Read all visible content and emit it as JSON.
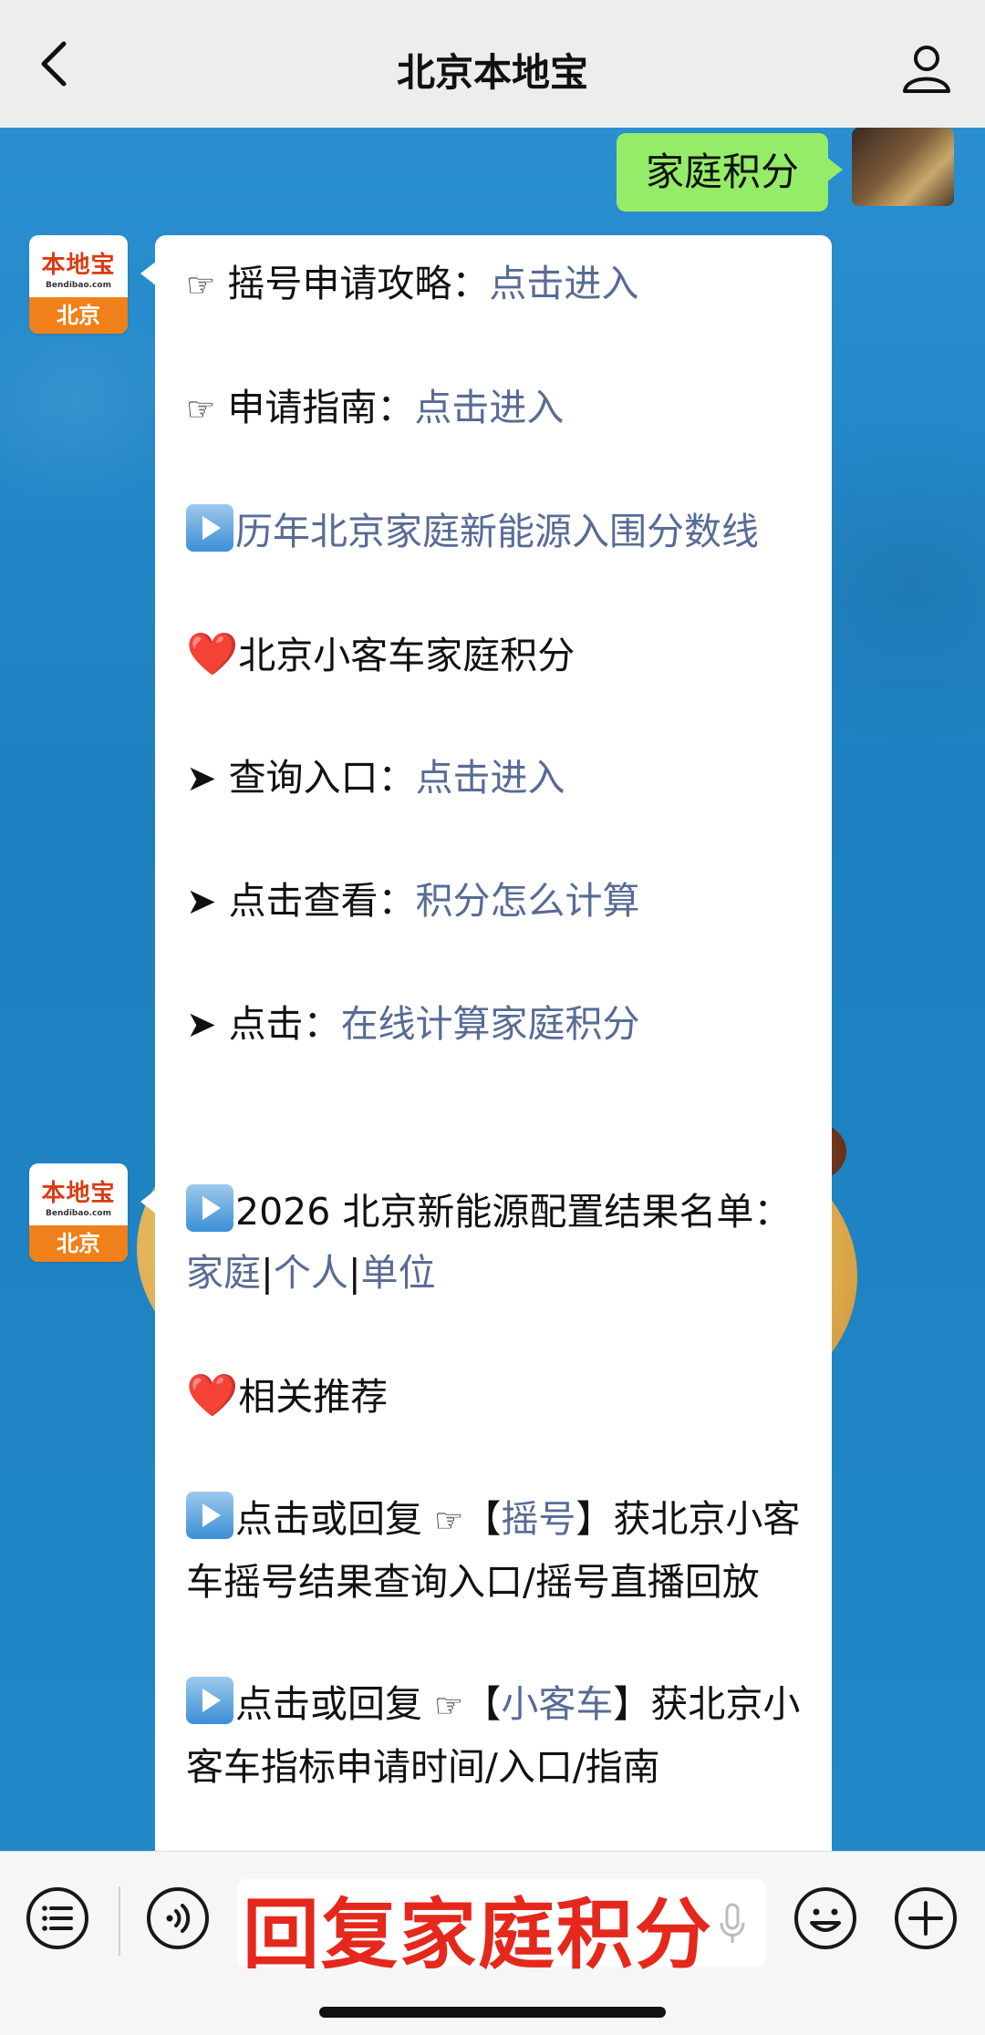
{
  "header": {
    "title": "北京本地宝"
  },
  "my_message": {
    "text": "家庭积分"
  },
  "account": {
    "logo_name": "本地宝",
    "logo_domain": "Bendibao.com",
    "logo_city": "北京"
  },
  "message1": {
    "line1": {
      "prefix": "☞",
      "label": "摇号申请攻略：",
      "link": "点击进入"
    },
    "line2": {
      "prefix": "☞",
      "label": "申请指南：",
      "link": "点击进入"
    },
    "line3": {
      "link": "历年北京家庭新能源入围分数线"
    },
    "line4": {
      "prefix": "❤️",
      "label": "北京小客车家庭积分"
    },
    "line5": {
      "prefix": "➤",
      "label": "查询入口：",
      "link": "点击进入"
    },
    "line6": {
      "prefix": "➤",
      "label": "点击查看：",
      "link": "积分怎么计算"
    },
    "line7": {
      "prefix": "➤",
      "label": "点击：",
      "link": "在线计算家庭积分"
    }
  },
  "message2": {
    "line1": {
      "label": "2026 北京新能源配置结果名单：",
      "link_a": "家庭",
      "sep1": "|",
      "link_b": "个人",
      "sep2": "|",
      "link_c": "单位"
    },
    "line2": {
      "prefix": "❤️",
      "label": "相关推荐"
    },
    "line3": {
      "label_a": "点击或回复 ",
      "hand": "☞",
      "bracket_open": "【",
      "link": "摇号",
      "bracket_close": "】",
      "label_b": "获北京小客车摇号结果查询入口/摇号直播回放"
    },
    "line4": {
      "label_a": "点击或回复 ",
      "hand": "☞",
      "bracket_open": "【",
      "link": "小客车",
      "bracket_close": "】",
      "label_b": "获北京小客车指标申请时间/入口/指南"
    }
  },
  "input": {
    "text": "回复家庭积分"
  },
  "icons": [
    "back-icon",
    "user-icon",
    "menu-icon",
    "voice-icon",
    "mic-icon",
    "emoji-icon",
    "plus-icon",
    "play-icon"
  ]
}
